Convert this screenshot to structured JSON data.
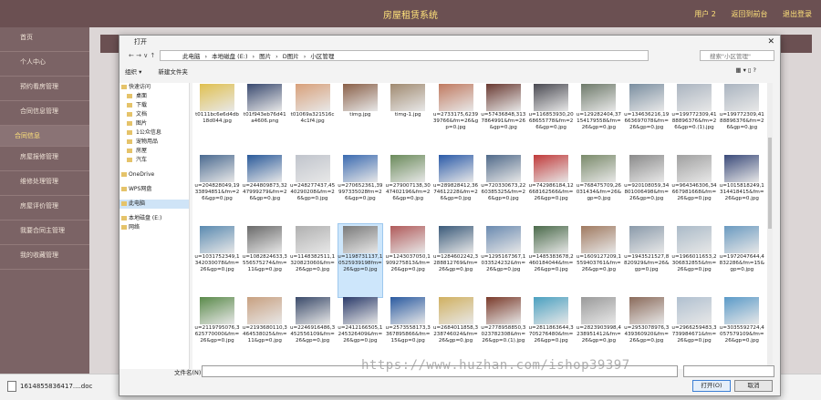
{
  "app": {
    "title": "房屋租赁系统",
    "user_label": "用户 2",
    "links": [
      "返回到前台",
      "退出登录"
    ]
  },
  "sidebar": {
    "items": [
      {
        "label": "首页"
      },
      {
        "label": "个人中心"
      },
      {
        "label": "预约看房管理"
      },
      {
        "label": "合同信息管理"
      },
      {
        "label": "合同信息",
        "sub": true
      },
      {
        "label": "房屋报修管理"
      },
      {
        "label": "维修处理管理"
      },
      {
        "label": "房屋评价管理"
      },
      {
        "label": "我要合同主管理"
      },
      {
        "label": "我的收藏管理"
      }
    ]
  },
  "download_bar": {
    "file": "1614855836417....doc"
  },
  "dialog": {
    "title": "打开",
    "path": [
      "此电脑",
      "本地磁盘 (E:)",
      "图片",
      "D图片",
      "小区管理"
    ],
    "search_placeholder": "搜索\"小区管理\"",
    "toolbar": {
      "organize": "组织 ▾",
      "new_folder": "新建文件夹"
    },
    "nav": [
      {
        "label": "快速访问",
        "top": true
      },
      {
        "label": "桌面"
      },
      {
        "label": "下载"
      },
      {
        "label": "文档"
      },
      {
        "label": "图片"
      },
      {
        "label": "1公众信息"
      },
      {
        "label": "宠物用品"
      },
      {
        "label": "房屋"
      },
      {
        "label": "汽车"
      },
      {
        "label": "OneDrive",
        "top": true
      },
      {
        "label": "WPS网盘",
        "top": true
      },
      {
        "label": "此电脑",
        "top": true,
        "selected": true
      },
      {
        "label": "本地磁盘 (E:)",
        "top": true
      },
      {
        "label": "网络",
        "top": true
      }
    ],
    "files": [
      {
        "name": "t0111bc6e6d4db18d044.jpg",
        "color": "#e0c050"
      },
      {
        "name": "t01f943eb76d41a4606.png",
        "color": "#3a4a70"
      },
      {
        "name": "t01069a321516c4c1f4.jpg",
        "color": "#d8a07a"
      },
      {
        "name": "timg.jpg",
        "color": "#8a6048"
      },
      {
        "name": "timg-1.jpg",
        "color": "#a08a70"
      },
      {
        "name": "u=2733175,623939766&fm=26&gp=0.jpg",
        "color": "#c07a60"
      },
      {
        "name": "u=57436848,3137864991&fm=26&gp=0.jpg",
        "color": "#6a3a32"
      },
      {
        "name": "u=116853930,2068655778&fm=26&gp=0.jpg",
        "color": "#4a4a52"
      },
      {
        "name": "u=129282404,37154179558&fm=26&gp=0.jpg",
        "color": "#6e7a6a"
      },
      {
        "name": "u=134636216,19663697078&fm=26&gp=0.jpg",
        "color": "#7a8ea0"
      },
      {
        "name": "u=199772309,4188896376&fm=26&gp=0.(1).jpg",
        "color": "#aab4c0"
      },
      {
        "name": "u=199772309,4188896376&fm=26&gp=0.jpg",
        "color": "#aab4c0"
      },
      {
        "name": "u=204828049,1933894851&fm=26&gp=0.jpg",
        "color": "#4a6a90"
      },
      {
        "name": "u=244809873,3247999279&fm=26&gp=0.jpg",
        "color": "#2a5a9a"
      },
      {
        "name": "u=248277437,4540290208&fm=26&gp=0.jpg",
        "color": "#c0c4cc"
      },
      {
        "name": "u=270652361,39997335028fm=26&gp=0.jpg",
        "color": "#3a6ab0"
      },
      {
        "name": "u=279007138,3047402196&fm=26&gp=0.jpg",
        "color": "#6a8a5a"
      },
      {
        "name": "u=289828412,3674612228&fm=26&gp=0.jpg",
        "color": "#2a5aa8"
      },
      {
        "name": "u=720330673,2260385325&fm=26&gp=0.jpg",
        "color": "#506a8a"
      },
      {
        "name": "u=742986184,12668162566&fm=26&gp=0.jpg",
        "color": "#c03a3a"
      },
      {
        "name": "u=768475709,26031434&fm=26&gp=0.jpg",
        "color": "#7a8a6a"
      },
      {
        "name": "u=920108059,34801006498&fm=26&gp=0.jpg",
        "color": "#8a8a8a"
      },
      {
        "name": "u=964346306,34667981668&fm=26&gp=0.jpg",
        "color": "#a0a0a0"
      },
      {
        "name": "u=1015818249,1314418415&fm=26&gp=0.jpg",
        "color": "#3a4a7a"
      },
      {
        "name": "u=1031752349,1342030078&fm=26&gp=0.jpg",
        "color": "#5a8ab0"
      },
      {
        "name": "u=1082824633,3556575274&fm=11&gp=0.jpg",
        "color": "#6a6a6a"
      },
      {
        "name": "u=1148382511,1320823060&fm=26&gp=0.jpg",
        "color": "#b0b0b0"
      },
      {
        "name": "u=1198731137,10525939198fm=26&gp=0.jpg",
        "color": "#7a7a7a",
        "selected": true
      },
      {
        "name": "u=1243037050,1909275813&fm=26&gp=0.jpg",
        "color": "#b05a5a"
      },
      {
        "name": "u=1284602242,3288812769&fm=26&gp=0.jpg",
        "color": "#3a5a7a"
      },
      {
        "name": "u=1295167367,1033524232&fm=26&gp=0.jpg",
        "color": "#6a8ab0"
      },
      {
        "name": "u=1485383678,2460184044&fm=26&gp=0.jpg",
        "color": "#4a6a4a"
      },
      {
        "name": "u=1609127209,1559403761&fm=26&gp=0.jpg",
        "color": "#a07a60"
      },
      {
        "name": "u=1943521527,8820929&fm=26&gp=0.jpg",
        "color": "#8a9aaa"
      },
      {
        "name": "u=1966011653,2306832855&fm=26&gp=0.jpg",
        "color": "#aabac8"
      },
      {
        "name": "u=1972047644,4832286&fm=15&gp=0.jpg",
        "color": "#6a9ac0"
      },
      {
        "name": "u=2119795076,3625770000&fm=26&gp=0.jpg",
        "color": "#5a8a4a"
      },
      {
        "name": "u=2193680110,3464538025&fm=11&gp=0.jpg",
        "color": "#c8a080"
      },
      {
        "name": "u=2246916486,3452556109&fm=26&gp=0.jpg",
        "color": "#3a4a6a"
      },
      {
        "name": "u=2412166505,1245326409&fm=26&gp=0.jpg",
        "color": "#2a3a6a"
      },
      {
        "name": "u=2573558173,3367895866&fm=15&gp=0.jpg",
        "color": "#2a5aa0"
      },
      {
        "name": "u=2684011858,3238746024&fm=26&gp=0.jpg",
        "color": "#d0b060"
      },
      {
        "name": "u=2778958850,3023782308&fm=26&gp=0.(1).jpg",
        "color": "#7a3a2a"
      },
      {
        "name": "u=2811863644,3705276480&fm=26&gp=0.jpg",
        "color": "#4aa0c0"
      },
      {
        "name": "u=2823903998,4238951412&fm=26&gp=0.jpg",
        "color": "#9a9a9a"
      },
      {
        "name": "u=2953078976,3439360920&fm=26&gp=0.jpg",
        "color": "#8a6a5a"
      },
      {
        "name": "u=2966259483,3739984671&fm=26&gp=0.jpg",
        "color": "#b0c0d0"
      },
      {
        "name": "u=3035592724,4057579109&fm=26&gp=0.jpg",
        "color": "#5a9ac8"
      }
    ],
    "filename_label": "文件名(N):",
    "open_button": "打开(O)",
    "cancel_button": "取消"
  },
  "watermark": "https://www.huzhan.com/ishop39397"
}
